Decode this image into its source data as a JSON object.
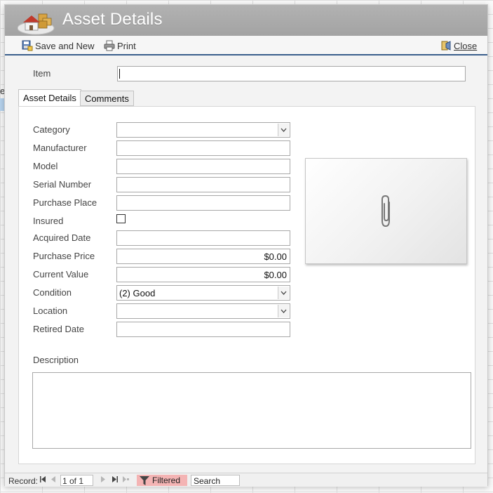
{
  "window": {
    "title": "Asset Details"
  },
  "toolbar": {
    "save_new_label": "Save and New",
    "print_label": "Print",
    "close_label": "Close"
  },
  "item": {
    "label": "Item",
    "value": ""
  },
  "tabs": [
    {
      "label": "Asset Details",
      "active": true
    },
    {
      "label": "Comments",
      "active": false
    }
  ],
  "fields": {
    "category": {
      "label": "Category",
      "value": ""
    },
    "manufacturer": {
      "label": "Manufacturer",
      "value": ""
    },
    "model": {
      "label": "Model",
      "value": ""
    },
    "serial_number": {
      "label": "Serial Number",
      "value": ""
    },
    "purchase_place": {
      "label": "Purchase Place",
      "value": ""
    },
    "insured": {
      "label": "Insured",
      "checked": false
    },
    "acquired_date": {
      "label": "Acquired Date",
      "value": ""
    },
    "purchase_price": {
      "label": "Purchase Price",
      "value": "$0.00"
    },
    "current_value": {
      "label": "Current Value",
      "value": "$0.00"
    },
    "condition": {
      "label": "Condition",
      "value": "(2) Good"
    },
    "location": {
      "label": "Location",
      "value": ""
    },
    "retired_date": {
      "label": "Retired Date",
      "value": ""
    },
    "description": {
      "label": "Description",
      "value": ""
    }
  },
  "attachment": {
    "icon": "paperclip-icon"
  },
  "statusbar": {
    "record_label": "Record:",
    "record_position": "1 of 1",
    "filtered_label": "Filtered",
    "search_placeholder": "Search"
  },
  "background": {
    "edge_text": "e"
  },
  "colors": {
    "title_bar": "#a8a8a8",
    "toolbar_rule": "#3a5f8c",
    "filtered_badge": "#f4b4b4"
  }
}
